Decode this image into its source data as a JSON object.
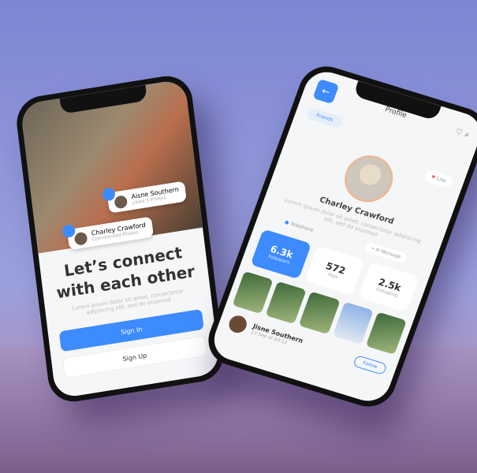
{
  "onboarding": {
    "notifications": [
      {
        "name": "Aisne Southern",
        "action": "Liked 3 Photos"
      },
      {
        "name": "Charley Crawford",
        "action": "Commented Photos"
      }
    ],
    "headline": "Let’s connect with each other",
    "description": "Lorem ipsum dolor sit amet, consectetur adipiscing elit, sed do eiusmod",
    "sign_in": "Sign In",
    "sign_up": "Sign Up"
  },
  "profile": {
    "title": "Profile",
    "back_icon": "←",
    "chip": "Friends",
    "like": "Like",
    "name": "Charley Crawford",
    "bio": "Lorem ipsum dolor sit amet, consectetur adipiscing elit, sed do eiusmod",
    "telephone": "Telephone",
    "message": "Message",
    "stats": [
      {
        "value": "6.3k",
        "label": "Followers"
      },
      {
        "value": "572",
        "label": "Post"
      },
      {
        "value": "2.5k",
        "label": "Following"
      }
    ],
    "user": {
      "name": "Jisne Southern",
      "time": "23 Sep at 04:12",
      "follow": "Follow"
    },
    "accent": "#3d8bfd"
  }
}
